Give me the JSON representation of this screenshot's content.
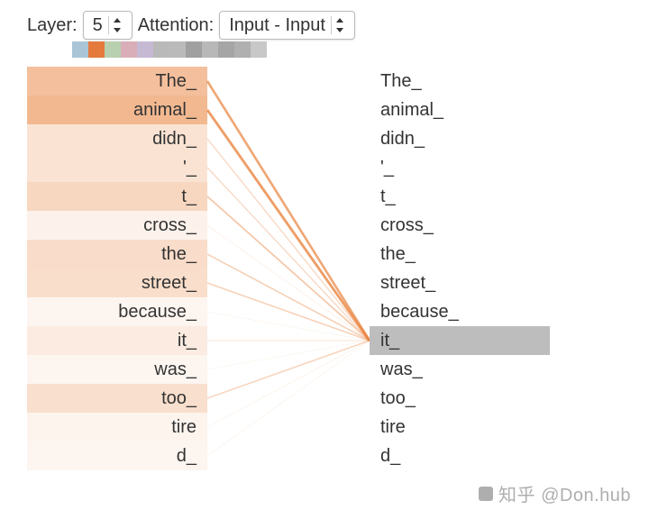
{
  "controls": {
    "layer_label": "Layer:",
    "layer_value": "5",
    "attention_label": "Attention:",
    "attention_value": "Input - Input"
  },
  "palette": [
    "#a9c5d6",
    "#e47a3c",
    "#b8cfb0",
    "#d9aeb9",
    "#c6b9d4",
    "#b9b9b9",
    "#bababa",
    "#a0a0a0",
    "#b8b8b8",
    "#a5a5a5",
    "#b0b0b0",
    "#c8c8c8"
  ],
  "tokens": [
    "The_",
    "animal_",
    "didn_",
    "'_",
    "t_",
    "cross_",
    "the_",
    "street_",
    "because_",
    "it_",
    "was_",
    "too_",
    "tire",
    "d_"
  ],
  "selected_right_index": 9,
  "attention_weights": [
    0.85,
    0.95,
    0.33,
    0.32,
    0.5,
    0.1,
    0.42,
    0.4,
    0.05,
    0.2,
    0.05,
    0.38,
    0.07,
    0.05
  ],
  "colors": {
    "attn_base": "#e9843f",
    "highlight": "#bdbdbd"
  },
  "watermark": "知乎 @Don.hub"
}
